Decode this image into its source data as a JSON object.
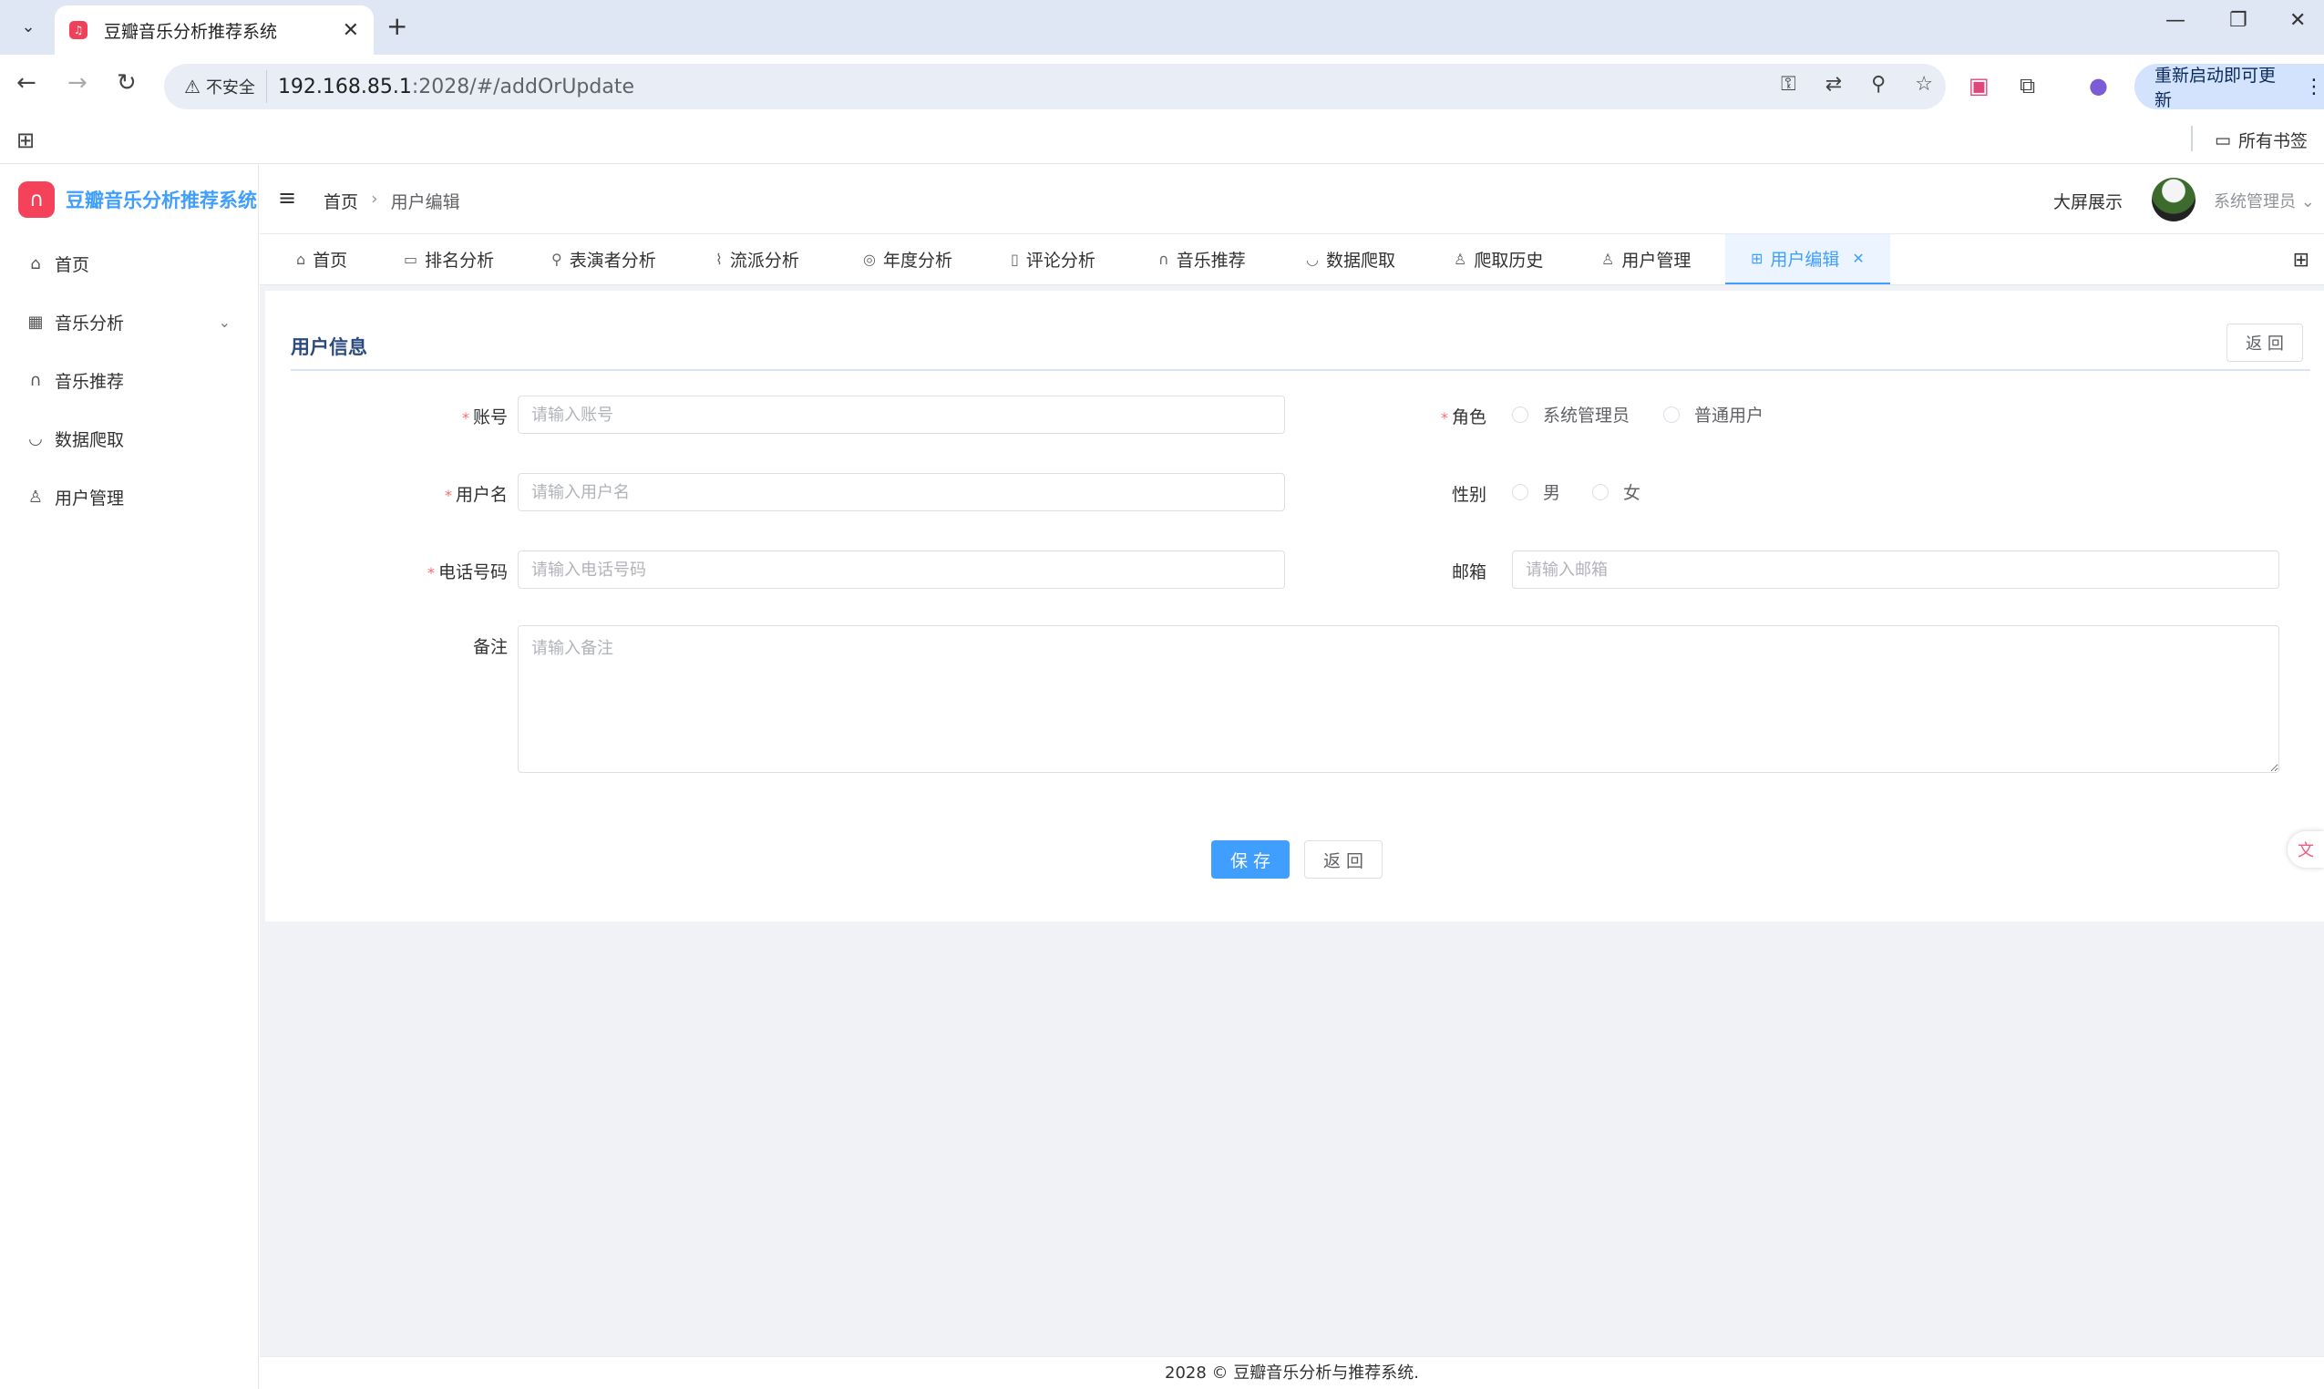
{
  "browser": {
    "tab_title": "豆瓣音乐分析推荐系统",
    "not_secure": "不安全",
    "url_host": "192.168.85.1",
    "url_rest": ":2028/#/addOrUpdate",
    "update_button": "重新启动即可更新",
    "all_bookmarks": "所有书签"
  },
  "app": {
    "logo_text": "豆瓣音乐分析推荐系统",
    "menu": [
      {
        "label": "首页"
      },
      {
        "label": "音乐分析"
      },
      {
        "label": "音乐推荐"
      },
      {
        "label": "数据爬取"
      },
      {
        "label": "用户管理"
      }
    ]
  },
  "header": {
    "breadcrumb_home": "首页",
    "breadcrumb_current": "用户编辑",
    "big_screen": "大屏展示",
    "user_name": "系统管理员"
  },
  "tabs": [
    {
      "label": "首页"
    },
    {
      "label": "排名分析"
    },
    {
      "label": "表演者分析"
    },
    {
      "label": "流派分析"
    },
    {
      "label": "年度分析"
    },
    {
      "label": "评论分析"
    },
    {
      "label": "音乐推荐"
    },
    {
      "label": "数据爬取"
    },
    {
      "label": "爬取历史"
    },
    {
      "label": "用户管理"
    },
    {
      "label": "用户编辑",
      "active": true
    }
  ],
  "form": {
    "title": "用户信息",
    "back_top": "返 回",
    "account_label": "账号",
    "account_placeholder": "请输入账号",
    "username_label": "用户名",
    "username_placeholder": "请输入用户名",
    "phone_label": "电话号码",
    "phone_placeholder": "请输入电话号码",
    "role_label": "角色",
    "role_options": [
      "系统管理员",
      "普通用户"
    ],
    "gender_label": "性别",
    "gender_options": [
      "男",
      "女"
    ],
    "email_label": "邮箱",
    "email_placeholder": "请输入邮箱",
    "remark_label": "备注",
    "remark_placeholder": "请输入备注",
    "save_button": "保 存",
    "back_button": "返 回"
  },
  "footer": {
    "text": "2028 © 豆瓣音乐分析与推荐系统."
  },
  "colors": {
    "primary": "#409eff",
    "logo": "#f5425a",
    "required": "#f56c6c"
  }
}
